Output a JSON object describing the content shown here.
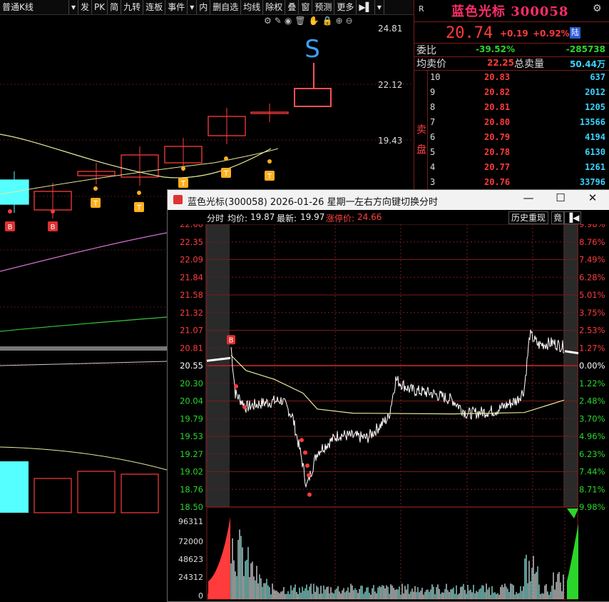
{
  "toolbar": {
    "items": [
      "普通K线",
      "▾",
      "发",
      "PK",
      "简",
      "九转",
      "连板",
      "事件",
      "▾",
      "内",
      "删自选",
      "均线",
      "除权",
      "叠",
      "窗",
      "预测",
      "更多",
      "▶▌",
      "▾"
    ]
  },
  "kline": {
    "price_labels": [
      "24.81",
      "22.12",
      "19.43"
    ],
    "signal_s": "S",
    "signal_b": "B",
    "signal_t": "T",
    "icons": [
      "gear-icon",
      "pen-icon",
      "eye-icon",
      "trash-icon",
      "hand-icon",
      "lock-icon",
      "zoom-in-icon",
      "zoom-out-icon"
    ]
  },
  "quote": {
    "r_mark": "R",
    "name": "蓝色光标 300058",
    "price": "20.74",
    "change": "+0.19",
    "change_pct": "+0.92%",
    "badge": "陆",
    "weibi_label": "委比",
    "weibi_pct": "-39.52%",
    "weibi_val": "-285738",
    "avg_label": "均卖价",
    "avg_val": "22.25",
    "total_label": "总卖量",
    "total_val": "50.44万",
    "sell_label": "卖盘",
    "orderbook": [
      {
        "level": "10",
        "price": "20.83",
        "vol": "637"
      },
      {
        "level": "9",
        "price": "20.82",
        "vol": "2012"
      },
      {
        "level": "8",
        "price": "20.81",
        "vol": "1205"
      },
      {
        "level": "7",
        "price": "20.80",
        "vol": "13566"
      },
      {
        "level": "6",
        "price": "20.79",
        "vol": "4194"
      },
      {
        "level": "5",
        "price": "20.78",
        "vol": "6130"
      },
      {
        "level": "4",
        "price": "20.77",
        "vol": "1261"
      },
      {
        "level": "3",
        "price": "20.76",
        "vol": "33796"
      }
    ]
  },
  "popup": {
    "title": "蓝色光标(300058) 2026-01-26 星期一",
    "hint": "左右方向键切换分时",
    "min_btn": "—",
    "max_btn": "☐",
    "close_btn": "✕",
    "tab_label": "分时",
    "avg_label": "均价:",
    "avg_value": "19.87",
    "latest_label": "最新:",
    "latest_value": "19.97",
    "limit_label": "涨停价:",
    "limit_value": "24.66",
    "history_btn": "历史重现",
    "jing_btn": "竟",
    "arrow_btn": "▐◀",
    "price_ticks": [
      "22.60",
      "22.35",
      "22.09",
      "21.84",
      "21.58",
      "21.32",
      "21.07",
      "20.81",
      "20.55",
      "20.30",
      "20.04",
      "19.79",
      "19.53",
      "19.27",
      "19.02",
      "18.76",
      "18.50"
    ],
    "pct_ticks": [
      "9.98%",
      "8.76%",
      "7.49%",
      "6.28%",
      "5.01%",
      "3.75%",
      "2.53%",
      "1.27%",
      "0.00%",
      "1.22%",
      "2.48%",
      "3.70%",
      "4.96%",
      "6.23%",
      "7.44%",
      "8.71%",
      "9.98%"
    ],
    "vol_ticks": [
      "96311",
      "72000",
      "48623",
      "24312",
      "0"
    ],
    "b_marker": "B",
    "colors": {
      "up": "#ff3b3b",
      "down": "#2bd62b",
      "price": "#ffffff",
      "avg": "#e8e89a",
      "grid": "#7a1b1b"
    }
  }
}
